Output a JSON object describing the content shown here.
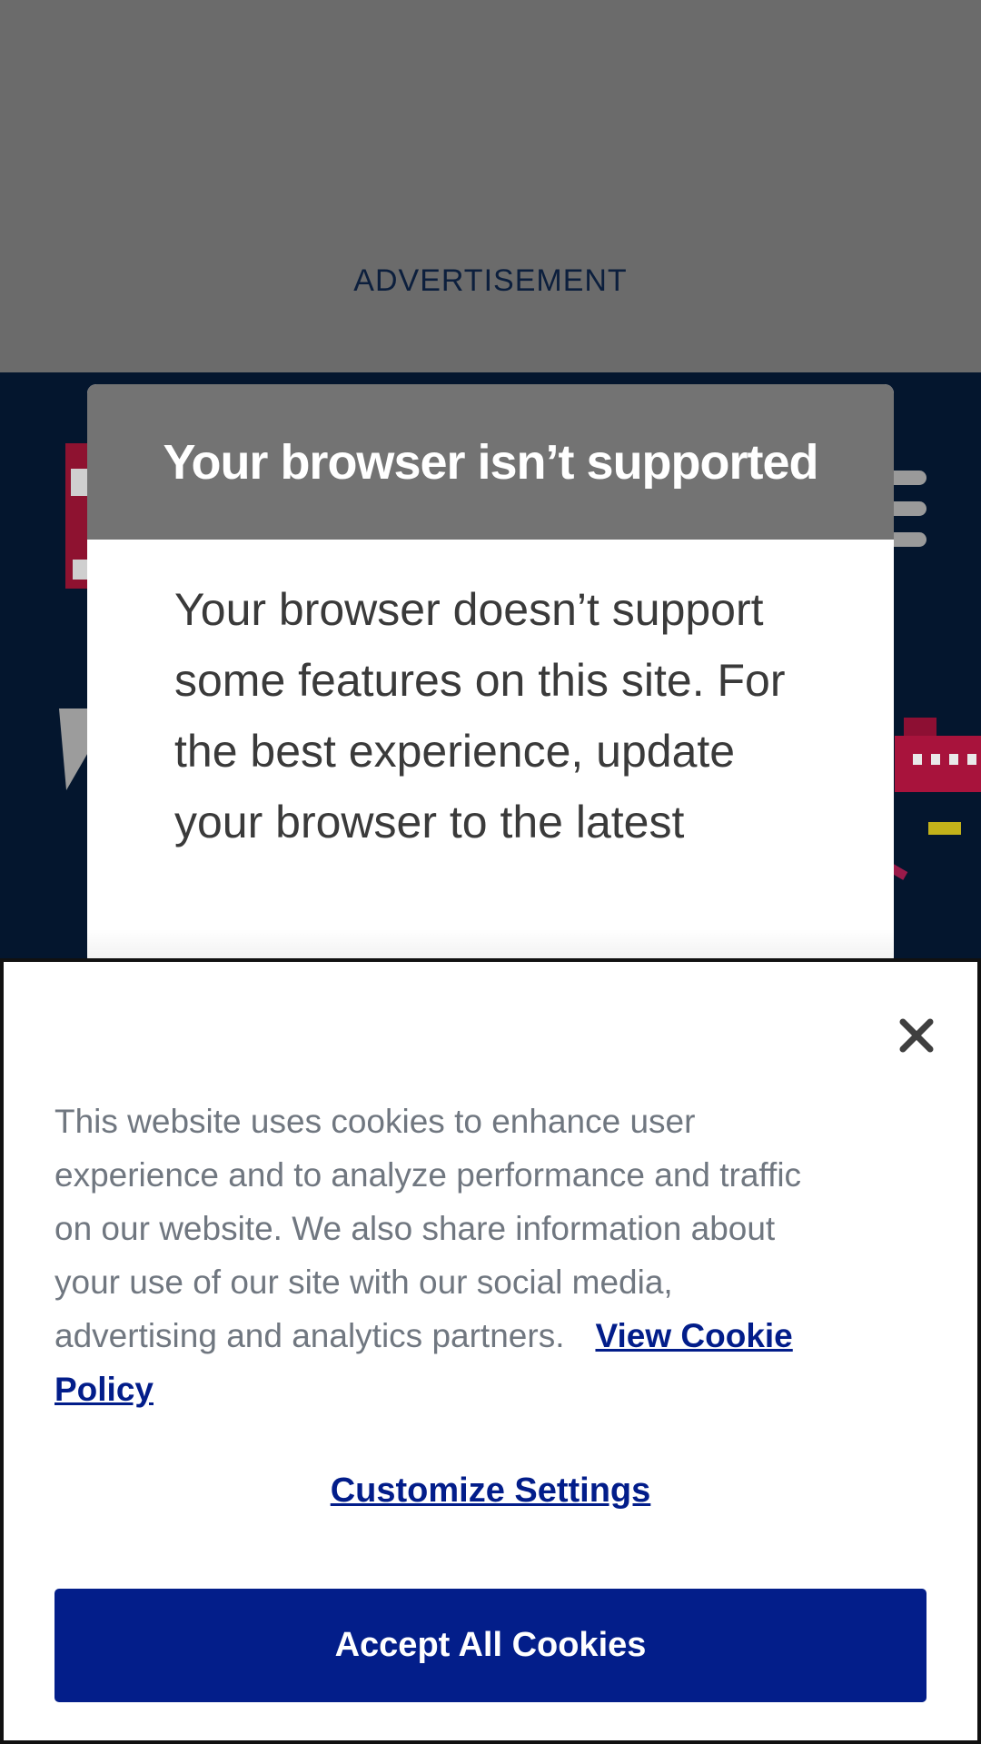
{
  "ad": {
    "label": "ADVERTISEMENT"
  },
  "modal": {
    "title": "Your browser isn’t supported",
    "body": "Your browser doesn’t support some features on this site. For the best experience, update your browser to the latest"
  },
  "cookie_banner": {
    "text": "This website uses cookies to enhance user experience and to analyze performance and traffic on our website. We also share information about your use of our site with our social media, advertising and analytics partners.",
    "policy_link": "View Cookie Policy",
    "customize_link": "Customize Settings",
    "accept_button": "Accept All Cookies",
    "close_icon": "close-icon"
  },
  "colors": {
    "ad_background": "#6b6b6b",
    "modal_header": "#737373",
    "link_blue": "#021d8a",
    "button_blue": "#031e8a",
    "page_navy": "#04162e"
  }
}
